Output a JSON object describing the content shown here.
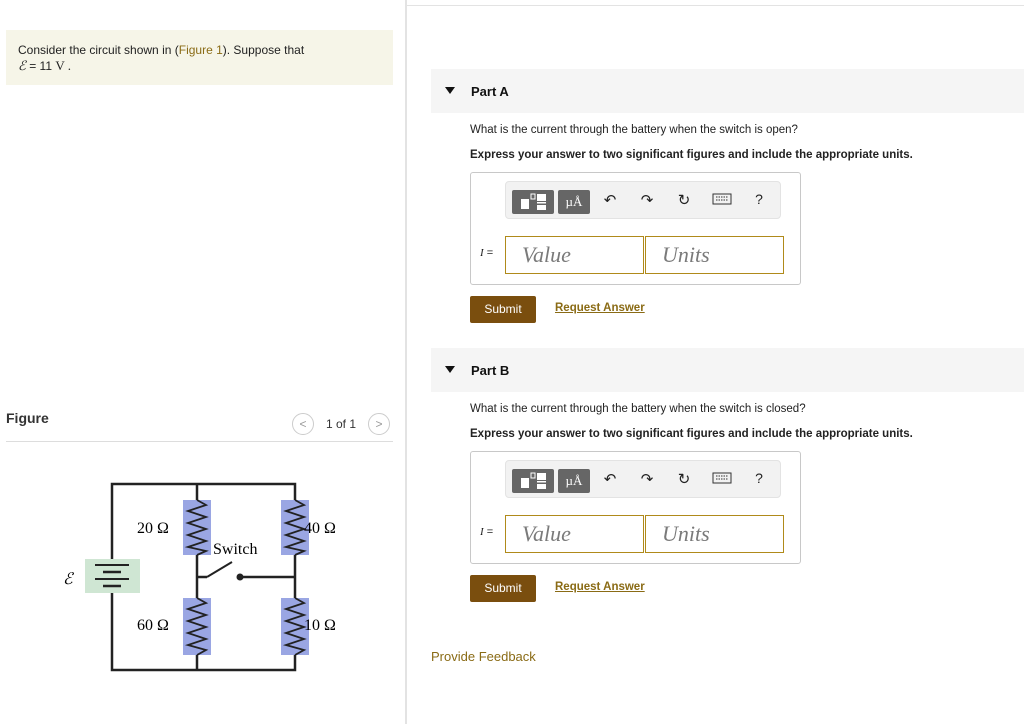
{
  "problem": {
    "text_before": "Consider the circuit shown in (",
    "figure_link": "Figure 1",
    "text_after": "). Suppose that",
    "emf_symbol": "ℰ",
    "emf_eq": " = 11 ",
    "emf_unit": "V",
    "emf_end": " ."
  },
  "figure": {
    "label": "Figure",
    "page_count": "1 of 1",
    "prev_icon": "chevron-left-icon",
    "next_icon": "chevron-right-icon"
  },
  "circuit": {
    "emf_label": "ℰ",
    "r_top_left": "20 Ω",
    "r_bottom_left": "60 Ω",
    "r_top_right": "40 Ω",
    "r_bottom_right": "10 Ω",
    "switch_label": "Switch",
    "resistor_color": "#9aa6e3",
    "battery_color": "#cfe6d3"
  },
  "parts": [
    {
      "title": "Part A",
      "question": "What is the current through the battery when the switch is open?",
      "instruction": "Express your answer to two significant figures and include the appropriate units.",
      "var_label": "I",
      "eq": " =",
      "value_placeholder": "Value",
      "units_placeholder": "Units",
      "units_button": "µÅ",
      "help": "?",
      "submit": "Submit",
      "request": "Request Answer"
    },
    {
      "title": "Part B",
      "question": "What is the current through the battery when the switch is closed?",
      "instruction": "Express your answer to two significant figures and include the appropriate units.",
      "var_label": "I",
      "eq": " =",
      "value_placeholder": "Value",
      "units_placeholder": "Units",
      "units_button": "µÅ",
      "help": "?",
      "submit": "Submit",
      "request": "Request Answer"
    }
  ],
  "feedback": "Provide Feedback",
  "colors": {
    "accent": "#7a4e0e",
    "link": "#8a6b15",
    "problem_bg": "#f6f5e8"
  }
}
